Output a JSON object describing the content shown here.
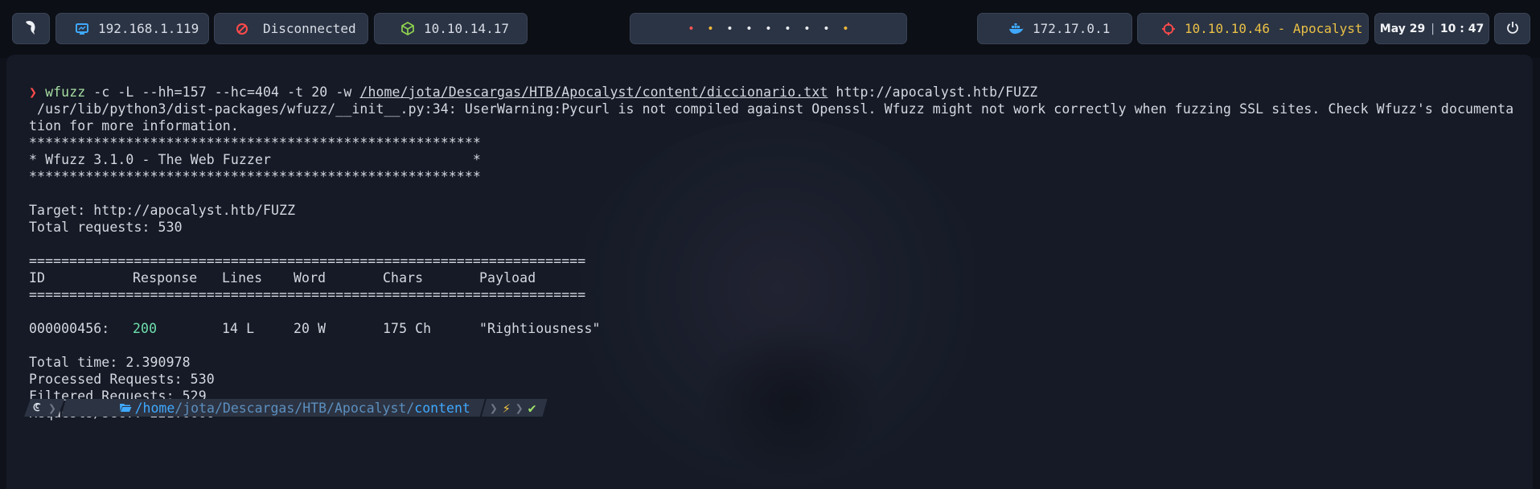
{
  "topbar": {
    "local_ip": "192.168.1.119",
    "vpn_status": "Disconnected",
    "htb_ip": "10.10.14.17",
    "workspaces": [
      {
        "glyph": "•",
        "color": "#ff5555"
      },
      {
        "glyph": "•",
        "color": "#f4b93a"
      },
      {
        "glyph": "•",
        "color": "#e8ebf0"
      },
      {
        "glyph": "•",
        "color": "#e8ebf0"
      },
      {
        "glyph": "•",
        "color": "#e8ebf0"
      },
      {
        "glyph": "•",
        "color": "#e8ebf0"
      },
      {
        "glyph": "•",
        "color": "#e8ebf0"
      },
      {
        "glyph": "•",
        "color": "#e8ebf0"
      },
      {
        "glyph": "•",
        "color": "#f4b93a"
      }
    ],
    "docker_ip": "172.17.0.1",
    "target": "10.10.10.46 - Apocalyst",
    "date": "May 29",
    "time": "10 : 47",
    "icons": {
      "menu": "bird-logo-icon",
      "ip": "monitor-icon",
      "vpn": "disconnected-icon",
      "htb": "cube-icon",
      "docker": "docker-whale-icon",
      "target": "crosshair-icon",
      "power": "power-icon"
    },
    "colors": {
      "target_text": "#e9c046",
      "accent_blue": "#3fa9ff",
      "danger": "#ff4b4b"
    }
  },
  "terminal": {
    "command": {
      "arrow": "❯",
      "program": "wfuzz",
      "args_pre": " -c -L --hh=157 --hc=404 -t 20 -w ",
      "wordlist": "/home/jota/Descargas/HTB/Apocalyst/content/diccionario.txt",
      "url": " http://apocalyst.htb/FUZZ"
    },
    "warning_1": " /usr/lib/python3/dist-packages/wfuzz/__init__.py:34: UserWarning:Pycurl is not compiled against Openssl. Wfuzz might not work correctly when fuzzing SSL sites. Check Wfuzz's documenta",
    "warning_2": "tion for more information.",
    "banner_border": "********************************************************",
    "banner_title": "* Wfuzz 3.1.0 - The Web Fuzzer                         *",
    "target_line": "Target: http://apocalyst.htb/FUZZ",
    "total_requests": "Total requests: 530",
    "separator": "=====================================================================",
    "headers": {
      "id": "ID",
      "response": "Response",
      "lines": "Lines",
      "word": "Word",
      "chars": "Chars",
      "payload": "Payload"
    },
    "result": {
      "id": "000000456:",
      "response": "200",
      "lines": "14 L",
      "word": "20 W",
      "chars": "175 Ch",
      "payload": "\"Rightiousness\""
    },
    "total_time": "Total time: 2.390978",
    "processed": "Processed Requests: 530",
    "filtered": "Filtered Requests: 529",
    "rate": "Requests/sec.: 221.6666"
  },
  "prompt": {
    "path_home": "/home",
    "path_mid": "/jota/Descargas/HTB/Apocalyst/",
    "path_last": "content",
    "bolt": "⚡",
    "check": "✔",
    "icons": {
      "os": "debian-swirl-icon",
      "folder": "folder-open-icon"
    }
  }
}
